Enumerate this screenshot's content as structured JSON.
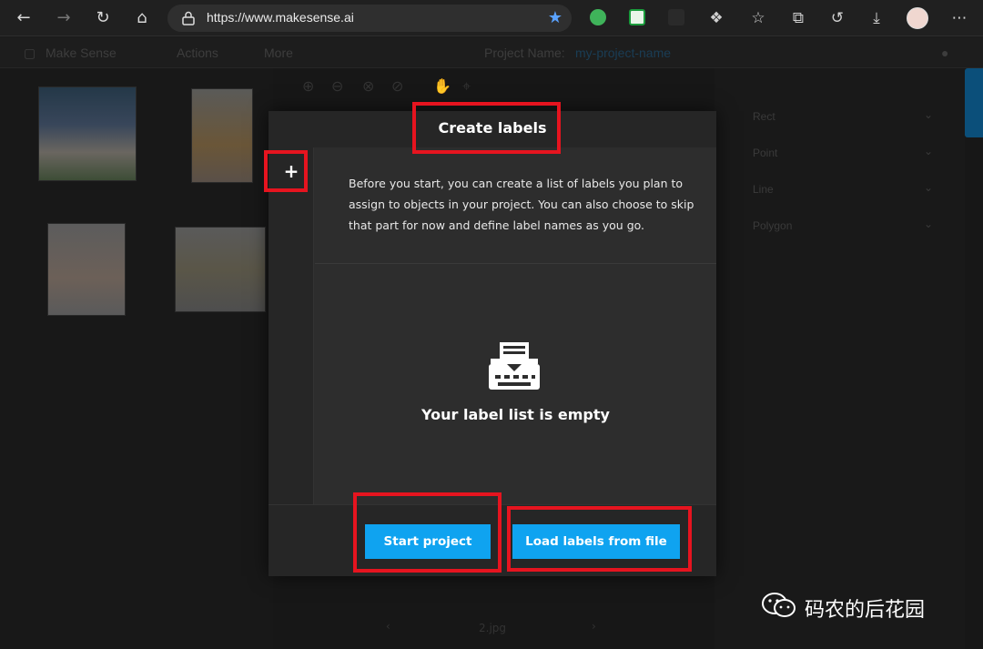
{
  "browser": {
    "url": "https://www.makesense.ai"
  },
  "app": {
    "title": "Make Sense",
    "menu_actions": "Actions",
    "menu_more": "More",
    "project_name_label": "Project Name:",
    "project_name_value": "my-project-name",
    "right_panel": {
      "items": [
        {
          "label": "Rect"
        },
        {
          "label": "Point"
        },
        {
          "label": "Line"
        },
        {
          "label": "Polygon"
        }
      ]
    },
    "bottom_nav": {
      "image_name": "2.jpg"
    }
  },
  "modal": {
    "title": "Create labels",
    "add_label": "+",
    "description": "Before you start, you can create a list of labels you plan to assign to objects in your project. You can also choose to skip that part for now and define label names as you go.",
    "empty_text": "Your label list is empty",
    "start_button": "Start project",
    "load_button": "Load labels from file"
  },
  "watermark": {
    "text": "码农的后花园"
  },
  "colors": {
    "accent": "#0fa3f0",
    "annotation": "#e6141f"
  }
}
